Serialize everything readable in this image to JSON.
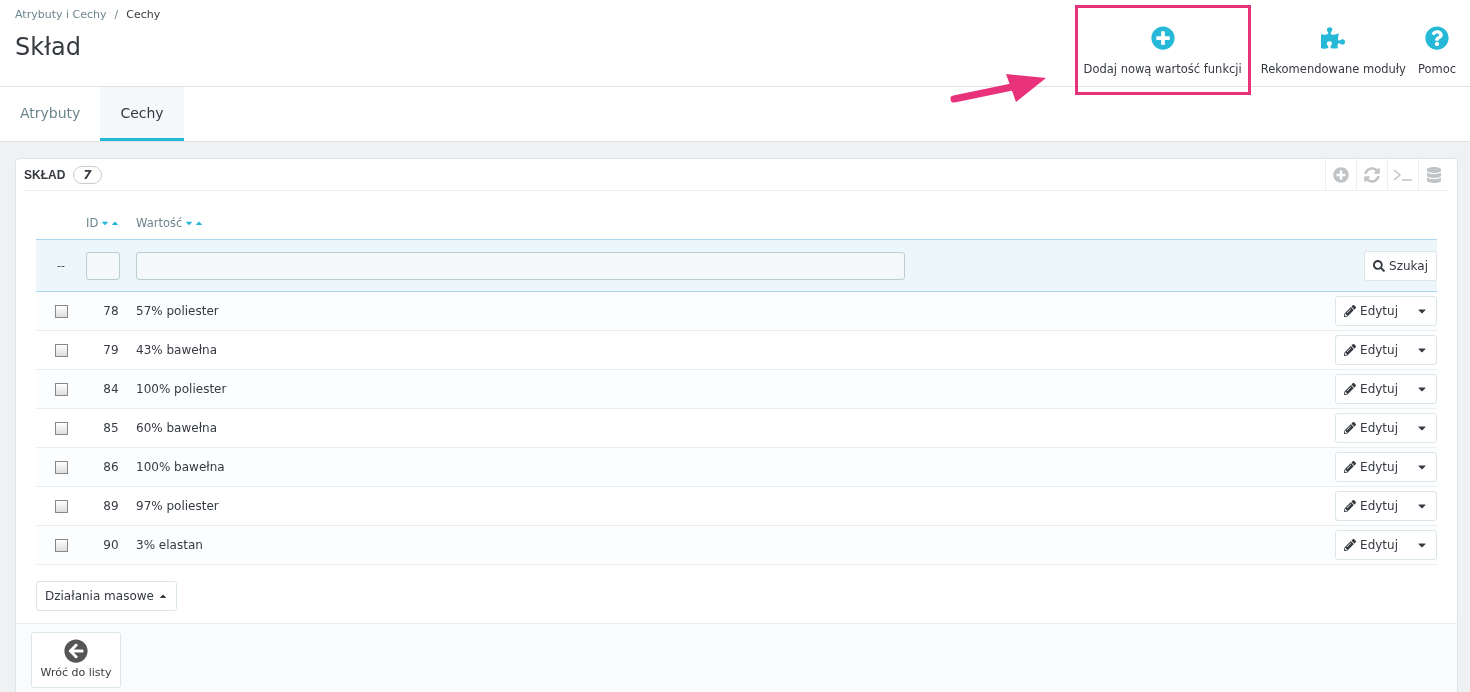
{
  "breadcrumb_separator": "/",
  "breadcrumb": [
    {
      "label": "Atrybuty i Cechy"
    },
    {
      "label": "Cechy"
    }
  ],
  "title": "Skład",
  "toolbar": [
    {
      "label": "Dodaj nową wartość funkcji",
      "kind": "add",
      "highlighted": true
    },
    {
      "label": "Rekomendowane moduły",
      "kind": "modules",
      "highlighted": false
    },
    {
      "label": "Pomoc",
      "kind": "help",
      "highlighted": false
    }
  ],
  "tabs": [
    {
      "label": "Atrybuty",
      "selected": false
    },
    {
      "label": "Cechy",
      "selected": true
    }
  ],
  "panel": {
    "title": "SKŁAD",
    "count": "7"
  },
  "table": {
    "columns": [
      {
        "label": "ID"
      },
      {
        "label": "Wartość"
      }
    ],
    "filter": {
      "bulk_mark": "--",
      "search_button": "Szukaj"
    },
    "rows": [
      {
        "id": "78",
        "value": "57% poliester",
        "checked": false,
        "action": "Edytuj"
      },
      {
        "id": "79",
        "value": "43% bawełna",
        "checked": false,
        "action": "Edytuj"
      },
      {
        "id": "84",
        "value": "100% poliester",
        "checked": false,
        "action": "Edytuj"
      },
      {
        "id": "85",
        "value": "60% bawełna",
        "checked": false,
        "action": "Edytuj"
      },
      {
        "id": "86",
        "value": "100% bawełna",
        "checked": false,
        "action": "Edytuj"
      },
      {
        "id": "89",
        "value": "97% poliester",
        "checked": false,
        "action": "Edytuj"
      },
      {
        "id": "90",
        "value": "3% elastan",
        "checked": false,
        "action": "Edytuj"
      }
    ]
  },
  "bulk_actions": "Działania masowe",
  "back_button": "Wróć do listy"
}
